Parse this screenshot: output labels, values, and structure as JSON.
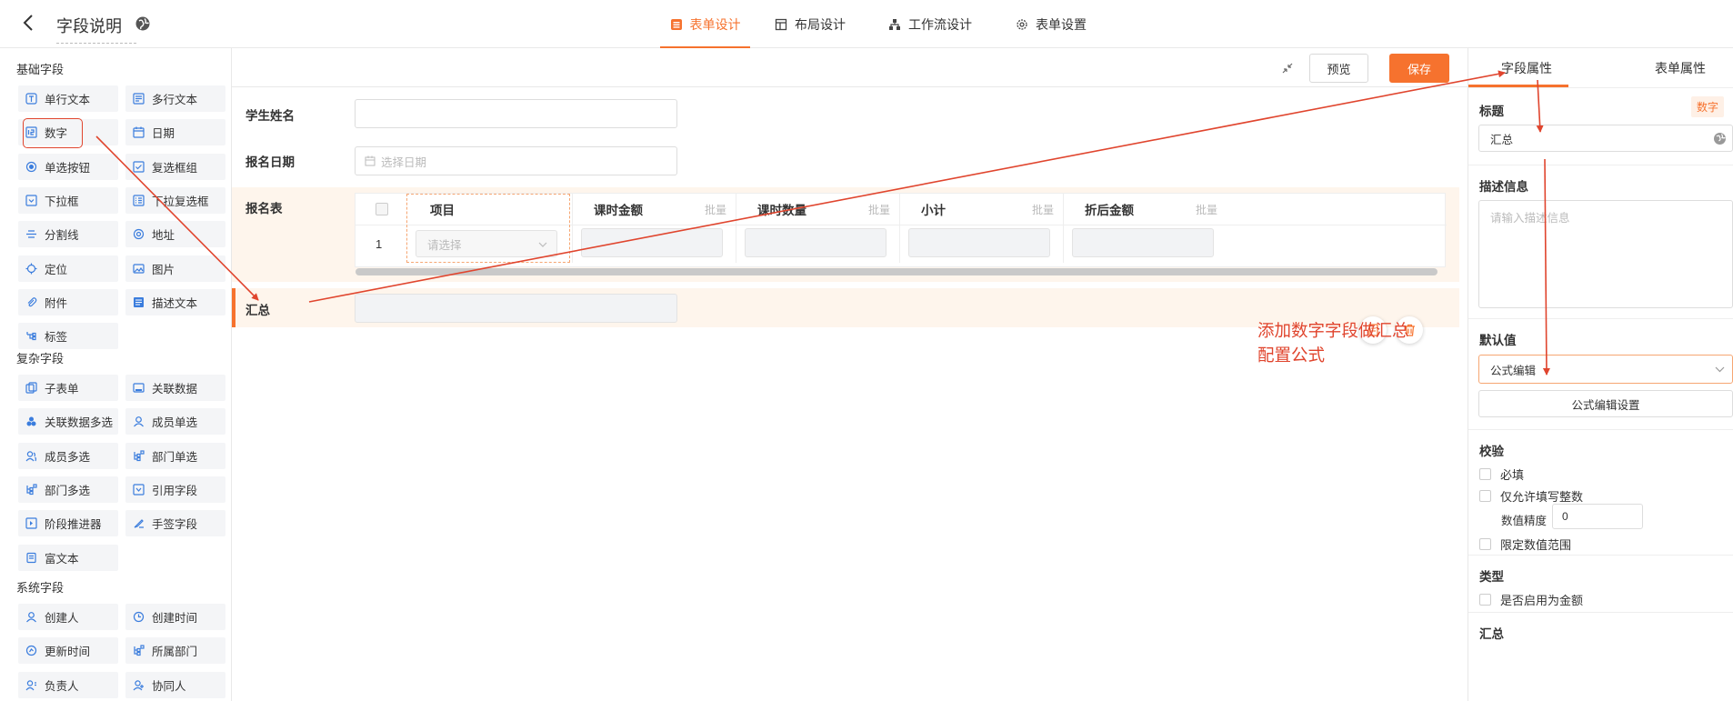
{
  "header": {
    "back_icon": "chevron-left-icon",
    "title": "字段说明",
    "tabs": [
      {
        "label": "表单设计",
        "icon": "form-icon",
        "active": true
      },
      {
        "label": "布局设计",
        "icon": "layout-icon",
        "active": false
      },
      {
        "label": "工作流设计",
        "icon": "workflow-icon",
        "active": false
      },
      {
        "label": "表单设置",
        "icon": "gear-icon",
        "active": false
      }
    ]
  },
  "left": {
    "basic_title": "基础字段",
    "basic": [
      "单行文本",
      "多行文本",
      "数字",
      "日期",
      "单选按钮",
      "复选框组",
      "下拉框",
      "下拉复选框",
      "分割线",
      "地址",
      "定位",
      "图片",
      "附件",
      "描述文本",
      "标签"
    ],
    "complex_title": "复杂字段",
    "complex": [
      "子表单",
      "关联数据",
      "关联数据多选",
      "成员单选",
      "成员多选",
      "部门单选",
      "部门多选",
      "引用字段",
      "阶段推进器",
      "手签字段",
      "富文本"
    ],
    "system_title": "系统字段",
    "system": [
      "创建人",
      "创建时间",
      "更新时间",
      "所属部门",
      "负责人",
      "协同人"
    ]
  },
  "toolbar": {
    "preview": "预览",
    "save": "保存"
  },
  "form": {
    "student_name_label": "学生姓名",
    "date_label": "报名日期",
    "date_placeholder": "选择日期",
    "table_label": "报名表",
    "table_columns": [
      "项目",
      "课时金额",
      "课时数量",
      "小计",
      "折后金额"
    ],
    "batch": "批量",
    "row_index": "1",
    "select_placeholder": "请选择",
    "summary_label": "汇总"
  },
  "annotation": {
    "line1": "添加数字字段做汇总",
    "line2": "配置公式"
  },
  "right": {
    "tab_field": "字段属性",
    "tab_form": "表单属性",
    "title_label": "标题",
    "type_badge": "数字",
    "title_value": "汇总",
    "desc_label": "描述信息",
    "desc_placeholder": "请输入描述信息",
    "default_label": "默认值",
    "default_value": "公式编辑",
    "formula_button": "公式编辑设置",
    "validation_label": "校验",
    "required": "必填",
    "integer_only": "仅允许填写整数",
    "precision_label": "数值精度",
    "precision_value": "0",
    "limit_range": "限定数值范围",
    "type_label": "类型",
    "enable_amount": "是否启用为金额",
    "summary_label": "汇总"
  },
  "colors": {
    "accent": "#f6722e",
    "annotation_red": "#e0452e",
    "icon_blue": "#3b7ddd",
    "selected_bg": "#fef5ec"
  }
}
